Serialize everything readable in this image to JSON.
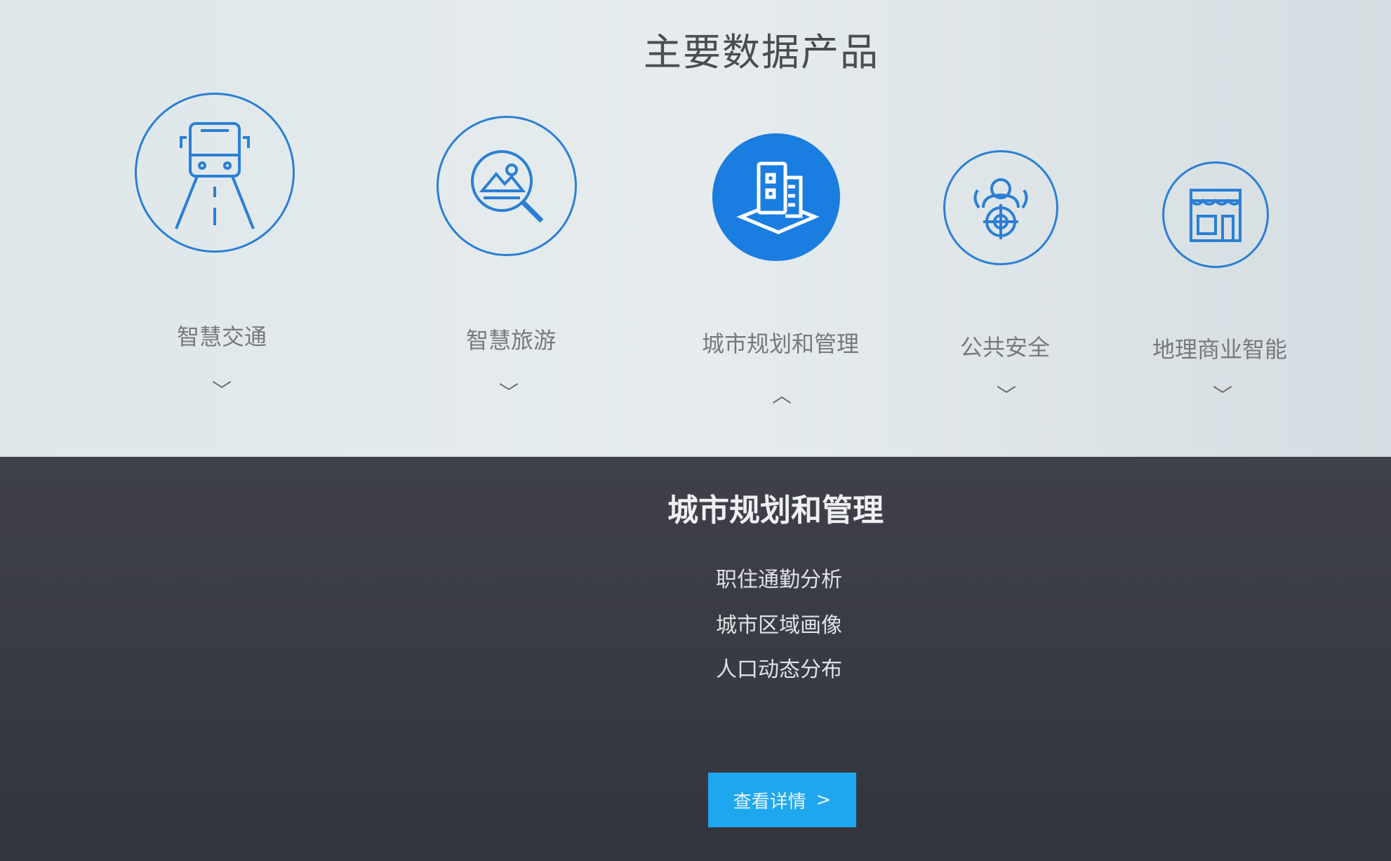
{
  "section_title": "主要数据产品",
  "products": [
    {
      "label": "智慧交通",
      "icon": "bus-road-icon",
      "expanded": false
    },
    {
      "label": "智慧旅游",
      "icon": "landscape-search-icon",
      "expanded": false
    },
    {
      "label": "城市规划和管理",
      "icon": "city-buildings-icon",
      "expanded": true
    },
    {
      "label": "公共安全",
      "icon": "people-target-icon",
      "expanded": false
    },
    {
      "label": "地理商业智能",
      "icon": "storefront-icon",
      "expanded": false
    }
  ],
  "chevrons": {
    "down": "﹀",
    "up": "︿"
  },
  "detail": {
    "title": "城市规划和管理",
    "items": [
      "职住通勤分析",
      "城市区域画像",
      "人口动态分布"
    ],
    "button_label": "查看详情",
    "button_arrow": ">"
  },
  "colors": {
    "accent": "#1a7de0",
    "button": "#1ea7ee",
    "panel": "#3c3e47"
  }
}
